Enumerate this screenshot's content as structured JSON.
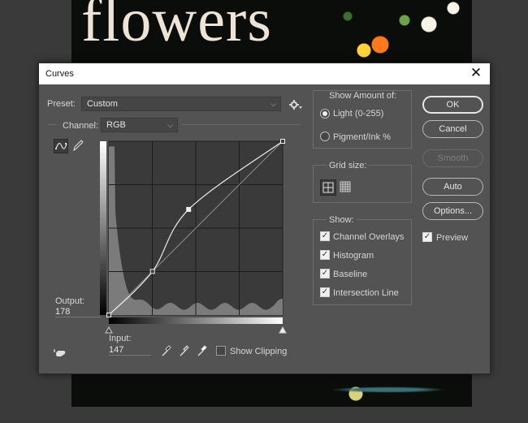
{
  "background_document": {
    "title_text": "flowers"
  },
  "dialog": {
    "title": "Curves",
    "preset": {
      "label": "Preset:",
      "value": "Custom"
    },
    "channel": {
      "label": "Channel:",
      "value": "RGB"
    },
    "output": {
      "label": "Output:",
      "value": "178"
    },
    "input": {
      "label": "Input:",
      "value": "147"
    },
    "show_clipping": {
      "label": "Show Clipping",
      "checked": false
    },
    "show_amount": {
      "legend": "Show Amount of:",
      "options": [
        {
          "label": "Light  (0-255)",
          "selected": true
        },
        {
          "label": "Pigment/Ink %",
          "selected": false
        }
      ]
    },
    "grid_size": {
      "legend": "Grid size:",
      "selected": "simple"
    },
    "show": {
      "legend": "Show:",
      "items": [
        {
          "label": "Channel Overlays",
          "checked": true
        },
        {
          "label": "Histogram",
          "checked": true
        },
        {
          "label": "Baseline",
          "checked": true
        },
        {
          "label": "Intersection Line",
          "checked": true
        }
      ]
    },
    "buttons": {
      "ok": "OK",
      "cancel": "Cancel",
      "smooth": "Smooth",
      "auto": "Auto",
      "options": "Options..."
    },
    "preview": {
      "label": "Preview",
      "checked": true
    }
  },
  "curve_data": {
    "range": [
      0,
      255
    ],
    "points": [
      [
        0,
        0
      ],
      [
        64,
        64
      ],
      [
        117,
        155
      ],
      [
        255,
        255
      ]
    ]
  }
}
